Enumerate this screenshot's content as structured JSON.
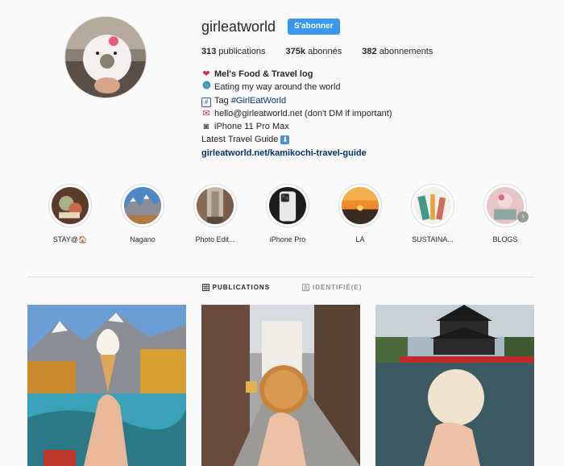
{
  "profile": {
    "username": "girleatworld",
    "follow_label": "S'abonner"
  },
  "stats": {
    "posts_count": "313",
    "posts_label": "publications",
    "followers_count": "375k",
    "followers_label": "abonnés",
    "following_count": "382",
    "following_label": "abonnements"
  },
  "bio": {
    "name": "Mel's Food & Travel log",
    "line1": "Eating my way around the world",
    "line2_prefix": "Tag",
    "line2_hashtag": "#GirlEatWorld",
    "line3": "hello@girleatworld.net (don't DM if important)",
    "line4": "iPhone 11 Pro Max",
    "line5": "Latest Travel Guide",
    "link": "girleatworld.net/kamikochi-travel-guide"
  },
  "highlights": [
    {
      "label": "STAY@🏠"
    },
    {
      "label": "Nagano"
    },
    {
      "label": "Photo Edit..."
    },
    {
      "label": "iPhone Pro"
    },
    {
      "label": "LA"
    },
    {
      "label": "SUSTAINA..."
    },
    {
      "label": "BLOGS"
    }
  ],
  "tabs": {
    "publications": "PUBLICATIONS",
    "tagged": "IDENTIFIÉ(E)"
  },
  "colors": {
    "accent": "#3897f0",
    "link": "#003569",
    "background": "#fafafa"
  }
}
